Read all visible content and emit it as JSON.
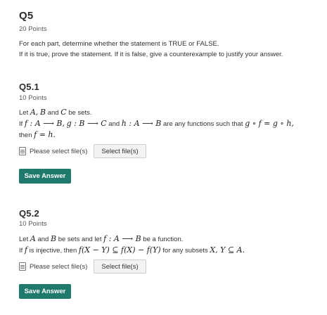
{
  "q5": {
    "title": "Q5",
    "points": "20 Points",
    "instructions": [
      "For each part, determine whether the statement is TRUE or FALSE.",
      "If it is true, prove the statement. If it is false, give a counterexample to justify your answer."
    ]
  },
  "q5_1": {
    "title": "Q5.1",
    "points": "10 Points",
    "text": {
      "line1_prefix": "Let",
      "line1_and": "and",
      "line1_suffix": "be sets.",
      "line2_if": "If",
      "line2_and": "and",
      "line2_are": "are  any functions such that",
      "line3_then": "then"
    },
    "math": {
      "A": "A,",
      "B": "B",
      "C": "C",
      "f_map": "f : A ⟶ B,",
      "g_map": "g : B ⟶ C",
      "h_map": "h : A ⟶ B",
      "gof": "g ∘ f = g ∘ h,",
      "conclusion": "f = h."
    },
    "upload_label": "Please select file(s)",
    "select_button": "Select file(s)",
    "save_button": "Save Answer"
  },
  "q5_2": {
    "title": "Q5.2",
    "points": "10 Points",
    "text": {
      "line1_prefix": "Let",
      "line1_and": "and",
      "line1_mid": "be sets and let",
      "line1_suffix": "be a function.",
      "line2_if": "If",
      "line2_inj": "is injective, then",
      "line2_for": "for any subsets"
    },
    "math": {
      "A": "A",
      "B": "B",
      "f_map": "f : A ⟶ B",
      "f": "f",
      "formula": "f(X − Y) ⊆ f(X) − f(Y)",
      "subsets": "X, Y ⊆ A."
    },
    "upload_label": "Please select file(s)",
    "select_button": "Select file(s)",
    "save_button": "Save Answer"
  },
  "colors": {
    "save_button_bg": "#1f7a6c",
    "text": "#2d2d2d"
  }
}
